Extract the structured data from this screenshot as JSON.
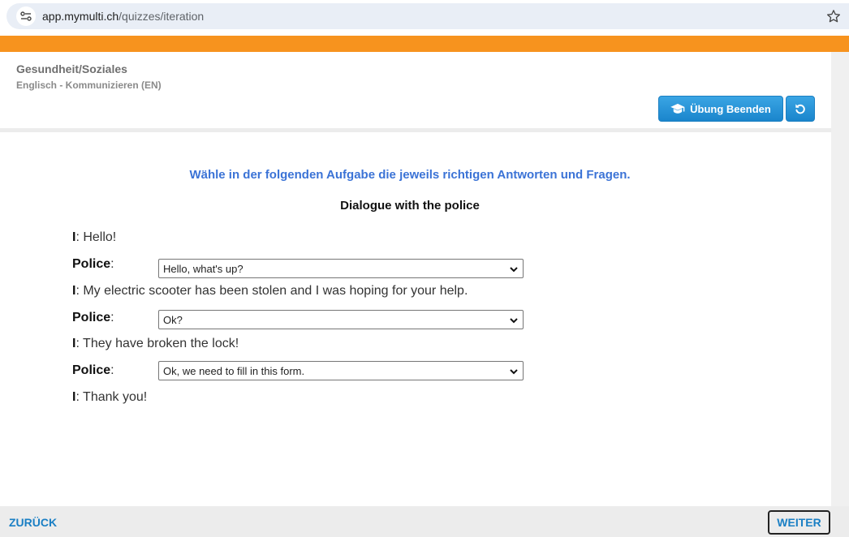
{
  "browser": {
    "url_host": "app.mymulti.ch",
    "url_path": "/quizzes/iteration"
  },
  "header": {
    "title": "Gesundheit/Soziales",
    "subtitle": "Englisch - Kommunizieren (EN)",
    "end_button_label": "Übung Beenden"
  },
  "content": {
    "instruction": "Wähle in der folgenden Aufgabe die jeweils richtigen Antworten und Fragen.",
    "dialogue_title": "Dialogue with the police",
    "lines": [
      {
        "speaker": "I",
        "text": ": Hello!"
      },
      {
        "speaker": "Police",
        "sep": ":",
        "selected": "Hello, what's up?"
      },
      {
        "speaker": "I",
        "text": ": My electric scooter has been stolen and I was hoping for your help."
      },
      {
        "speaker": "Police",
        "sep": ":",
        "selected": "Ok?"
      },
      {
        "speaker": "I",
        "text": ": They have broken the lock!"
      },
      {
        "speaker": "Police",
        "sep": ":",
        "selected": "Ok, we need to fill in this form."
      },
      {
        "speaker": "I",
        "text": ": Thank you!"
      }
    ]
  },
  "footer": {
    "back_label": "ZURÜCK",
    "next_label": "WEITER"
  },
  "colors": {
    "accent_orange": "#f7931e",
    "button_blue": "#1a85cc",
    "instruction_blue": "#3b73d6"
  }
}
